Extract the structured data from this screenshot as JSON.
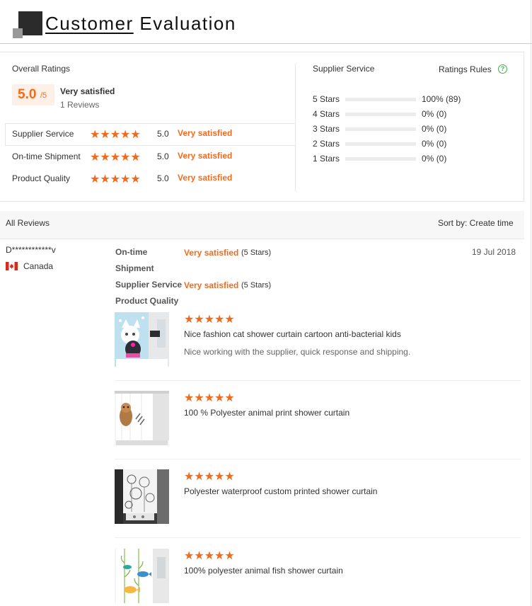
{
  "header": {
    "title_first": "Customer",
    "title_rest": " Evaluation"
  },
  "overall": {
    "label": "Overall Ratings",
    "score": "5.0",
    "score_max": "/5",
    "verdict": "Very satisfied",
    "reviews_count": "1 Reviews"
  },
  "dimensions": [
    {
      "label": "Supplier Service",
      "stars": "★★★★★",
      "score": "5.0",
      "text": "Very satisfied"
    },
    {
      "label": "On-time Shipment",
      "stars": "★★★★★",
      "score": "5.0",
      "text": "Very satisfied"
    },
    {
      "label": "Product Quality",
      "stars": "★★★★★",
      "score": "5.0",
      "text": "Very satisfied"
    }
  ],
  "supplier_service": {
    "label": "Supplier Service",
    "rules_label": "Ratings Rules",
    "rules_icon": "?",
    "distribution": [
      {
        "label": "5 Stars",
        "fraction": 1.0,
        "pct": "100%",
        "count": "(89)"
      },
      {
        "label": "4 Stars",
        "fraction": 0.0,
        "pct": "0%",
        "count": "(0)"
      },
      {
        "label": "3 Stars",
        "fraction": 0.0,
        "pct": "0%",
        "count": "(0)"
      },
      {
        "label": "2 Stars",
        "fraction": 0.0,
        "pct": "0%",
        "count": "(0)"
      },
      {
        "label": "1 Stars",
        "fraction": 0.0,
        "pct": "0%",
        "count": "(0)"
      }
    ]
  },
  "all_reviews": {
    "title": "All Reviews",
    "sort_label": "Sort by: Create time"
  },
  "review": {
    "reviewer": "D************v",
    "country": "Canada",
    "date": "19 Jul 2018",
    "ontime_label_1": "On-time",
    "ontime_label_2": "Shipment",
    "ontime_value": "Very satisfied",
    "ontime_stars": "(5 Stars)",
    "service_label": "Supplier Service",
    "service_value": "Very satisfied",
    "service_stars": "(5 Stars)",
    "quality_label": "Product Quality",
    "items": [
      {
        "stars": "★★★★★",
        "title": "Nice fashion cat shower curtain cartoon anti-bacterial kids",
        "comment": "Nice working with the supplier, quick response and shipping."
      },
      {
        "stars": "★★★★★",
        "title": "100 % Polyester animal print shower curtain",
        "comment": ""
      },
      {
        "stars": "★★★★★",
        "title": "Polyester waterproof custom printed shower curtain",
        "comment": ""
      },
      {
        "stars": "★★★★★",
        "title": "100% polyester animal fish shower curtain",
        "comment": ""
      }
    ]
  },
  "colors": {
    "accent": "#f26b1d",
    "help_green": "#3bb34a",
    "track": "#ececec"
  }
}
